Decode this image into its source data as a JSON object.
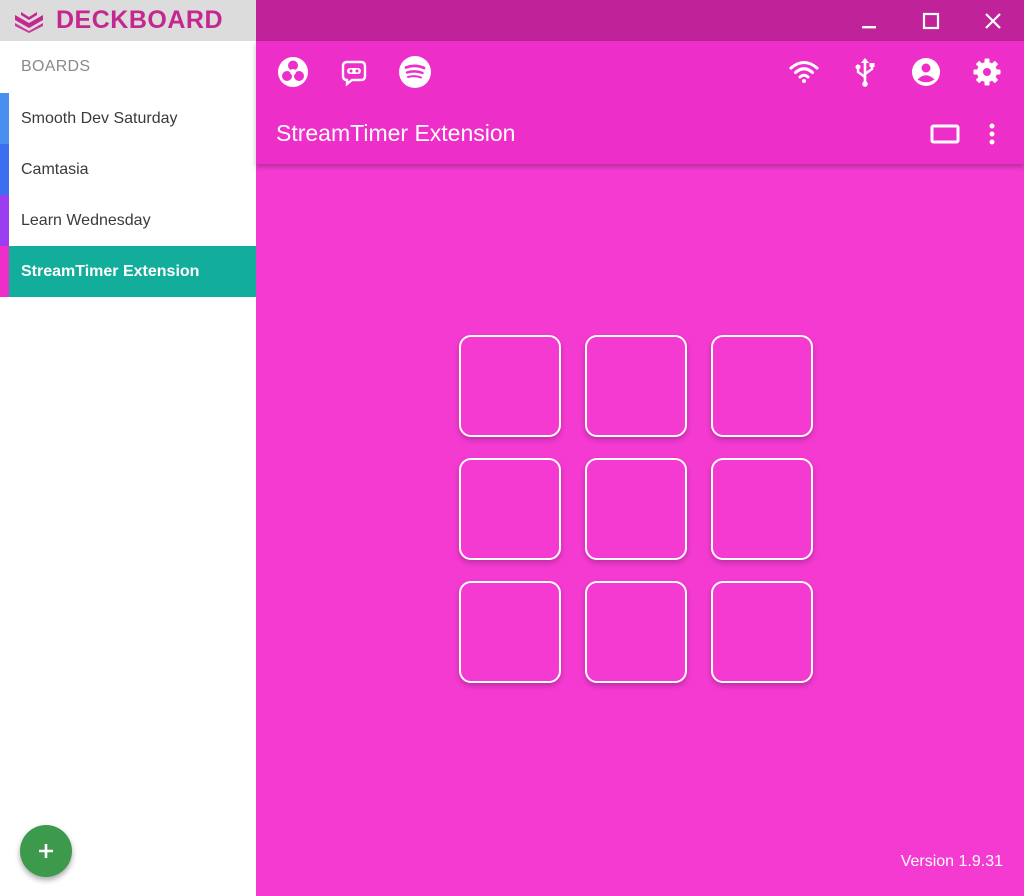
{
  "app": {
    "title": "DECKBOARD"
  },
  "colors": {
    "brand": "#c4278f",
    "titlebar": "#c0229a",
    "toolbar": "#ee2ec9",
    "canvas": "#f53ad2",
    "active": "#13ad9c",
    "fab": "#3d9a4c"
  },
  "window_controls": [
    {
      "name": "minimize-button",
      "icon": "minimize-icon"
    },
    {
      "name": "maximize-button",
      "icon": "maximize-icon"
    },
    {
      "name": "close-button",
      "icon": "close-icon"
    }
  ],
  "sidebar": {
    "header": "BOARDS",
    "items": [
      {
        "label": "Smooth Dev Saturday",
        "color": "#4a8ef0",
        "active": false
      },
      {
        "label": "Camtasia",
        "color": "#3b6ff0",
        "active": false
      },
      {
        "label": "Learn Wednesday",
        "color": "#9b3ef2",
        "active": false
      },
      {
        "label": "StreamTimer Extension",
        "color": "#ee2ec9",
        "active": true
      }
    ],
    "add_button": {
      "icon": "plus-icon"
    }
  },
  "toolbar": {
    "left_icons": [
      "obs-icon",
      "streamlabs-icon",
      "spotify-icon"
    ],
    "right_icons": [
      "wifi-icon",
      "usb-icon",
      "account-icon",
      "settings-icon"
    ],
    "board_title": "StreamTimer Extension",
    "actions": [
      "tablet-icon",
      "more-vert-icon"
    ]
  },
  "grid": {
    "rows": 3,
    "cols": 3
  },
  "footer": {
    "version": "Version 1.9.31"
  }
}
